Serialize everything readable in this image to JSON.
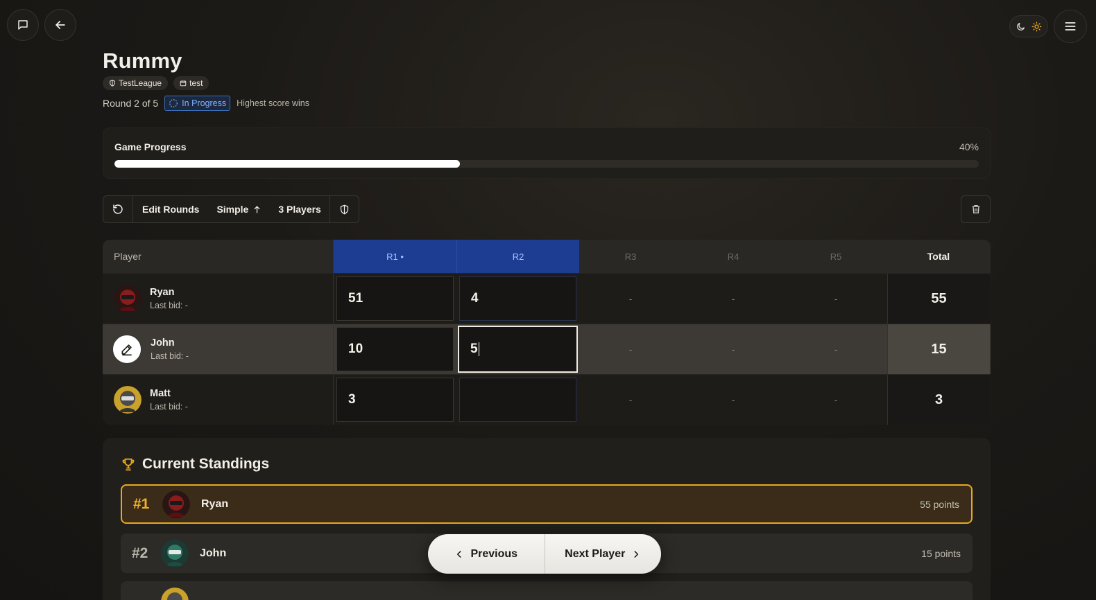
{
  "header": {
    "title": "Rummy",
    "tags": [
      {
        "icon": "shield-icon",
        "label": "TestLeague"
      },
      {
        "icon": "calendar-icon",
        "label": "test"
      }
    ],
    "round_text": "Round 2 of 5",
    "status": "In Progress",
    "win_condition": "Highest score wins"
  },
  "progress": {
    "label": "Game Progress",
    "percent_text": "40%",
    "value": 0.4
  },
  "toolbar": {
    "edit_rounds": "Edit Rounds",
    "mode": "Simple",
    "players": "3 Players"
  },
  "table": {
    "headers": {
      "player": "Player",
      "rounds": [
        "R1 •",
        "R2",
        "R3",
        "R4",
        "R5"
      ],
      "total": "Total"
    },
    "rows": [
      {
        "name": "Ryan",
        "sub": "Last bid: -",
        "scores": [
          "51",
          "4",
          "-",
          "-",
          "-"
        ],
        "total": "55"
      },
      {
        "name": "John",
        "sub": "Last bid: -",
        "scores": [
          "10",
          "5",
          "-",
          "-",
          "-"
        ],
        "total": "15"
      },
      {
        "name": "Matt",
        "sub": "Last bid: -",
        "scores": [
          "3",
          "",
          "-",
          "-",
          "-"
        ],
        "total": "3"
      }
    ]
  },
  "standings": {
    "title": "Current Standings",
    "rows": [
      {
        "rank": "#1",
        "name": "Ryan",
        "points": "55 points"
      },
      {
        "rank": "#2",
        "name": "John",
        "points": "15 points"
      }
    ]
  },
  "nav": {
    "previous": "Previous",
    "next": "Next Player"
  },
  "colors": {
    "accent_blue": "#1d3d93",
    "gold": "#e8a920",
    "status_blue": "#7fb2ff"
  }
}
